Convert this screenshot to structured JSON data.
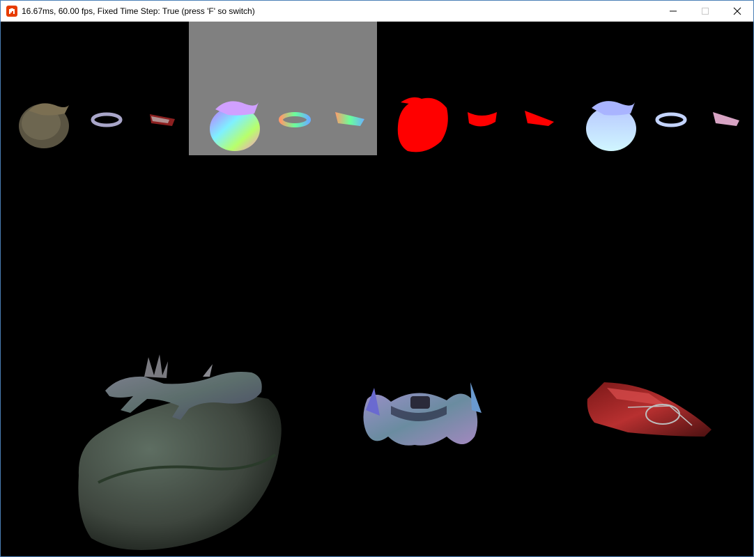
{
  "window": {
    "title": "16.67ms, 60.00 fps, Fixed Time Step: True (press 'F' so switch)",
    "icon": "monogame-icon",
    "buttons": [
      "minimize-icon",
      "maximize-icon",
      "close-icon"
    ],
    "accent_color": "#e73c00"
  },
  "viewport": {
    "background": "#000000",
    "gbuffer_panels": [
      {
        "name": "albedo",
        "background": "#000000"
      },
      {
        "name": "normals",
        "background": "#808080"
      },
      {
        "name": "depth",
        "background": "#000000",
        "tint": "#ff0000"
      },
      {
        "name": "lighting",
        "background": "#000000"
      }
    ],
    "models": [
      "lizard-on-rock",
      "ship-1",
      "ship-2"
    ]
  }
}
